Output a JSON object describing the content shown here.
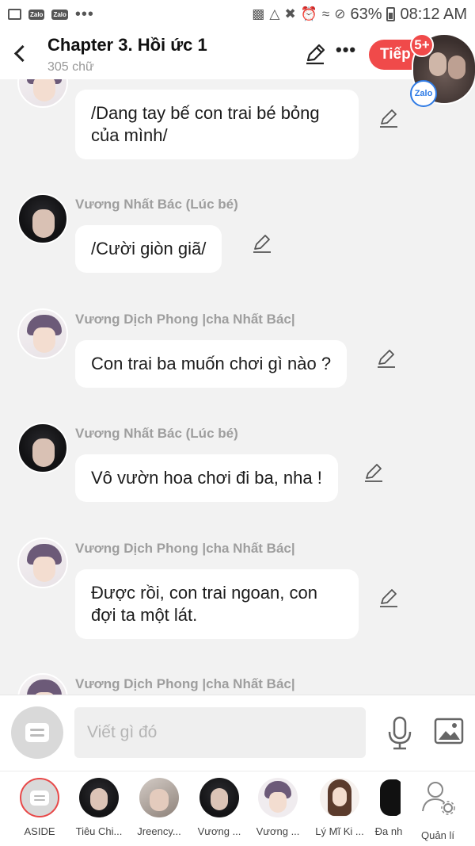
{
  "status_bar": {
    "zalo_1": "Zalo",
    "zalo_2": "Zalo",
    "dots": "•••",
    "battery": "63%",
    "time": "08:12 AM"
  },
  "header": {
    "title": "Chapter 3. Hồi ức 1",
    "word_count": "305 chữ",
    "more": "•••",
    "next_label": "Tiếp",
    "chat_head_badge": "5+",
    "zalo_badge": "Zalo"
  },
  "messages": [
    {
      "sender": "",
      "text": "/Dang tay bế con trai bé bỏng của mình/"
    },
    {
      "sender": "Vương Nhất Bác (Lúc bé)",
      "text": "/Cười giòn giã/"
    },
    {
      "sender": "Vương Dịch Phong |cha Nhất Bác|",
      "text": "Con trai ba muốn chơi gì nào ?"
    },
    {
      "sender": "Vương Nhất Bác (Lúc bé)",
      "text": "Vô vườn hoa chơi đi ba, nha !"
    },
    {
      "sender": "Vương Dịch Phong |cha Nhất Bác|",
      "text": "Được rồi, con trai ngoan, con đợi ta một lát."
    },
    {
      "sender": "Vương Dịch Phong |cha Nhất Bác|",
      "text": ""
    }
  ],
  "composer": {
    "placeholder": "Viết gì đó"
  },
  "characters": [
    {
      "label": "ASIDE"
    },
    {
      "label": "Tiêu Chi..."
    },
    {
      "label": "Jreency..."
    },
    {
      "label": "Vương ..."
    },
    {
      "label": "Vương ..."
    },
    {
      "label": "Lý Mĩ Ki ..."
    },
    {
      "label": "Đa nh"
    },
    {
      "label": "Quản lí"
    }
  ],
  "colors": {
    "accent": "#f04a4a",
    "background": "#f2f2f2",
    "bubble": "#ffffff",
    "sender_name": "#9e9e9e"
  }
}
